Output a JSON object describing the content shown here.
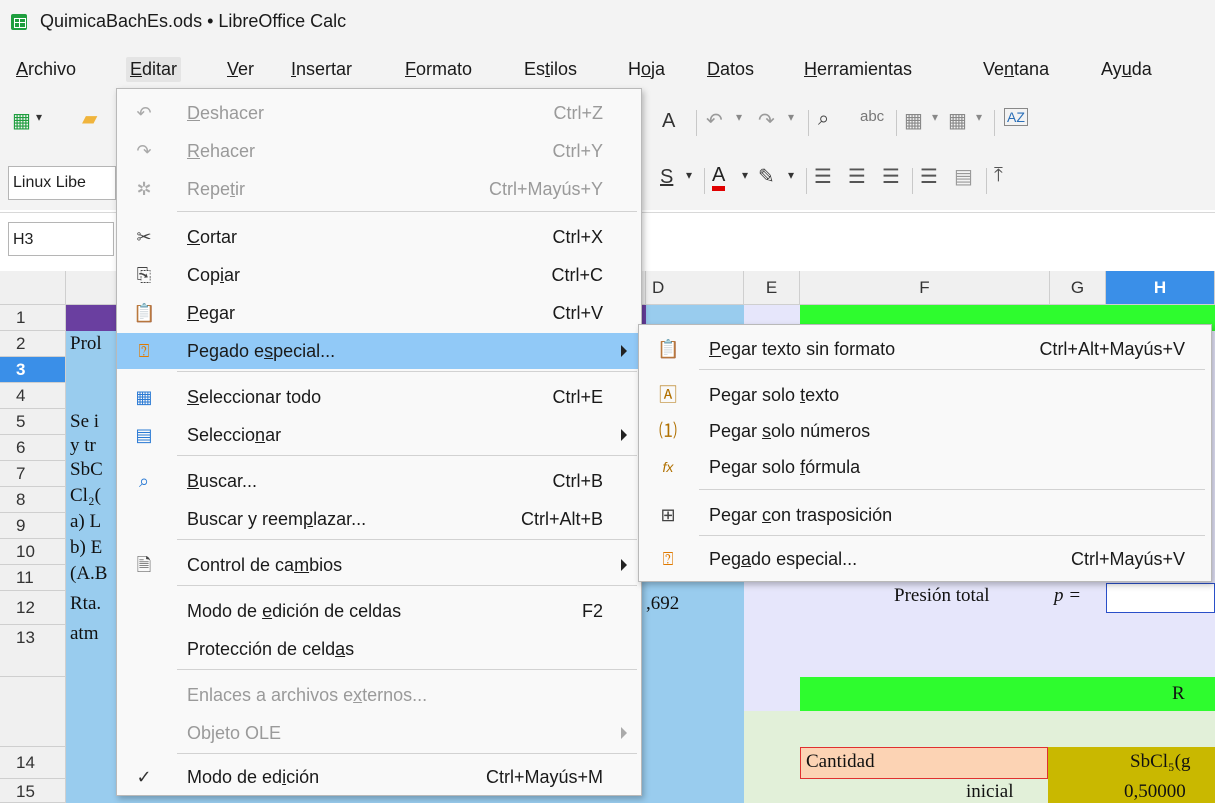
{
  "window": {
    "title": "QuimicaBachEs.ods • LibreOffice Calc"
  },
  "menubar": [
    "Archivo",
    "Editar",
    "Ver",
    "Insertar",
    "Formato",
    "Estilos",
    "Hoja",
    "Datos",
    "Herramientas",
    "Ventana",
    "Ayuda"
  ],
  "font_name": "Linux Libe",
  "name_box": "H3",
  "columns": [
    "D",
    "E",
    "F",
    "G",
    "H"
  ],
  "rows": [
    "1",
    "2",
    "3",
    "4",
    "5",
    "6",
    "7",
    "8",
    "9",
    "10",
    "11",
    "12",
    "13",
    "14",
    "15"
  ],
  "cells": {
    "b2": "Prol",
    "b5": "Se i",
    "b6": "y tr",
    "b7": "SbC",
    "b8": "Cl₂(",
    "b9": "a) L",
    "b10": "b) E",
    "b11": "(A.B",
    "b12": "Rta.",
    "b13": "atm",
    "d12": ",692",
    "f9_label": "Presión total",
    "f9_var": "p =",
    "h12": "R",
    "f14": "Cantidad",
    "h14": "SbCl₅(g",
    "f15": "inicial",
    "h15": "0,50000"
  },
  "edit_menu": {
    "items": [
      {
        "label": "Deshacer",
        "shortcut": "Ctrl+Z",
        "icon": "undo-icon",
        "disabled": true
      },
      {
        "label": "Rehacer",
        "shortcut": "Ctrl+Y",
        "icon": "redo-icon",
        "disabled": true
      },
      {
        "label": "Repetir",
        "shortcut": "Ctrl+Mayús+Y",
        "icon": "repeat-icon",
        "disabled": true
      },
      {
        "label": "Cortar",
        "shortcut": "Ctrl+X",
        "icon": "scissors-icon"
      },
      {
        "label": "Copiar",
        "shortcut": "Ctrl+C",
        "icon": "copy-icon"
      },
      {
        "label": "Pegar",
        "shortcut": "Ctrl+V",
        "icon": "paste-icon"
      },
      {
        "label": "Pegado especial...",
        "shortcut": "",
        "icon": "paste-special-icon",
        "submenu": true,
        "highlighted": true
      },
      {
        "label": "Seleccionar todo",
        "shortcut": "Ctrl+E",
        "icon": "select-all-icon"
      },
      {
        "label": "Seleccionar",
        "shortcut": "",
        "icon": "select-icon",
        "submenu": true
      },
      {
        "label": "Buscar...",
        "shortcut": "Ctrl+B",
        "icon": "search-icon"
      },
      {
        "label": "Buscar y reemplazar...",
        "shortcut": "Ctrl+Alt+B",
        "icon": ""
      },
      {
        "label": "Control de cambios",
        "shortcut": "",
        "icon": "track-changes-icon",
        "submenu": true
      },
      {
        "label": "Modo de edición de celdas",
        "shortcut": "F2",
        "icon": ""
      },
      {
        "label": "Protección de celdas",
        "shortcut": "",
        "icon": ""
      },
      {
        "label": "Enlaces a archivos externos...",
        "shortcut": "",
        "icon": "",
        "disabled": true
      },
      {
        "label": "Objeto OLE",
        "shortcut": "",
        "icon": "",
        "disabled": true,
        "submenu": true
      },
      {
        "label": "Modo de edición",
        "shortcut": "Ctrl+Mayús+M",
        "icon": "check-icon"
      }
    ]
  },
  "paste_special_submenu": {
    "items": [
      {
        "label": "Pegar texto sin formato",
        "shortcut": "Ctrl+Alt+Mayús+V",
        "icon": "paste-unformatted-icon"
      },
      {
        "label": "Pegar solo texto",
        "shortcut": "",
        "icon": "paste-text-icon"
      },
      {
        "label": "Pegar solo números",
        "shortcut": "",
        "icon": "paste-numbers-icon"
      },
      {
        "label": "Pegar solo fórmula",
        "shortcut": "",
        "icon": "paste-formula-icon"
      },
      {
        "label": "Pegar con trasposición",
        "shortcut": "",
        "icon": "paste-transpose-icon"
      },
      {
        "label": "Pegado especial...",
        "shortcut": "Ctrl+Mayús+V",
        "icon": "paste-special-icon"
      }
    ]
  },
  "colors": {
    "highlight": "#91c9f7",
    "green": "#2efc2e",
    "lavender": "#e6e6fb",
    "lightgreen": "#e2f0d9",
    "olive": "#c9b800",
    "salmon": "#fcd3b4",
    "purple": "#6a3fa0",
    "blue_col": "#99ccee"
  }
}
